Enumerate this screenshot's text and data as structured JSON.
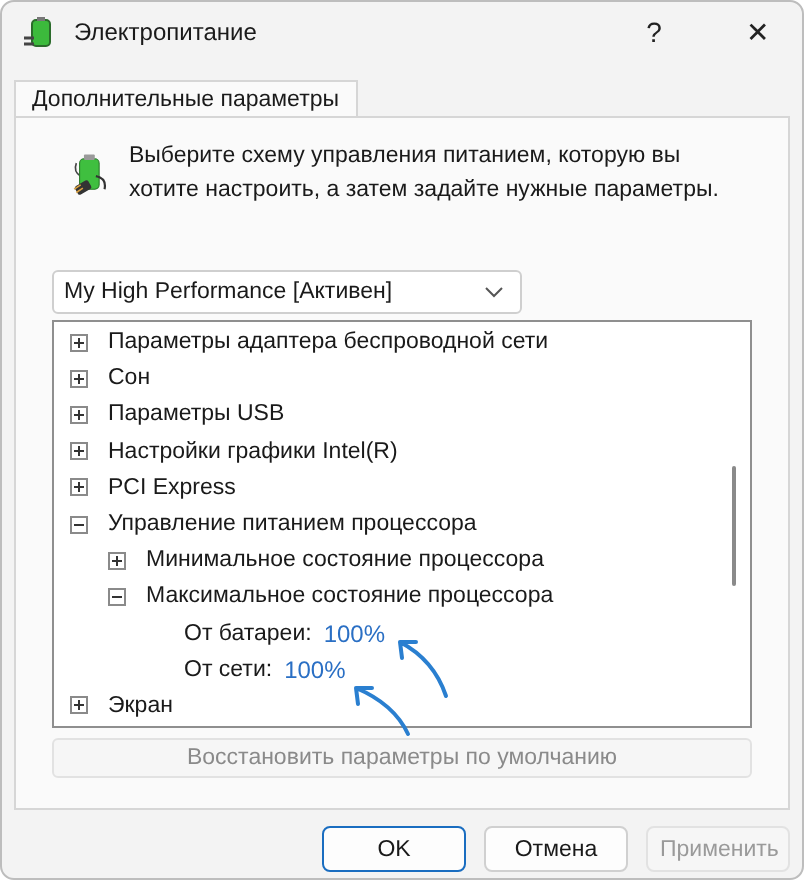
{
  "window": {
    "title": "Электропитание",
    "help_button": "?",
    "close_button": "✕"
  },
  "tabs": [
    {
      "label": "Дополнительные параметры",
      "selected": true
    }
  ],
  "description": "Выберите схему управления питанием, которую вы хотите настроить, а затем задайте нужные параметры.",
  "plan_dropdown": {
    "value": "My High Performance [Активен]"
  },
  "tree": [
    {
      "label": "Параметры адаптера беспроводной сети",
      "expanded": false
    },
    {
      "label": "Сон",
      "expanded": false
    },
    {
      "label": "Параметры USB",
      "expanded": false
    },
    {
      "label": "Настройки графики Intel(R)",
      "expanded": false
    },
    {
      "label": "PCI Express",
      "expanded": false
    },
    {
      "label": "Управление питанием процессора",
      "expanded": true,
      "children": [
        {
          "label": "Минимальное состояние процессора",
          "expanded": false
        },
        {
          "label": "Максимальное состояние процессора",
          "expanded": true,
          "children": [
            {
              "label": "От батареи:",
              "value": "100%"
            },
            {
              "label": "От сети:",
              "value": "100%"
            }
          ]
        }
      ]
    },
    {
      "label": "Экран",
      "expanded": false
    }
  ],
  "restore_button": {
    "label": "Восстановить параметры по умолчанию",
    "disabled": true
  },
  "buttons": [
    {
      "label": "OK",
      "disabled": false,
      "default": true
    },
    {
      "label": "Отмена",
      "disabled": false,
      "default": false
    },
    {
      "label": "Применить",
      "disabled": true,
      "default": false
    }
  ]
}
